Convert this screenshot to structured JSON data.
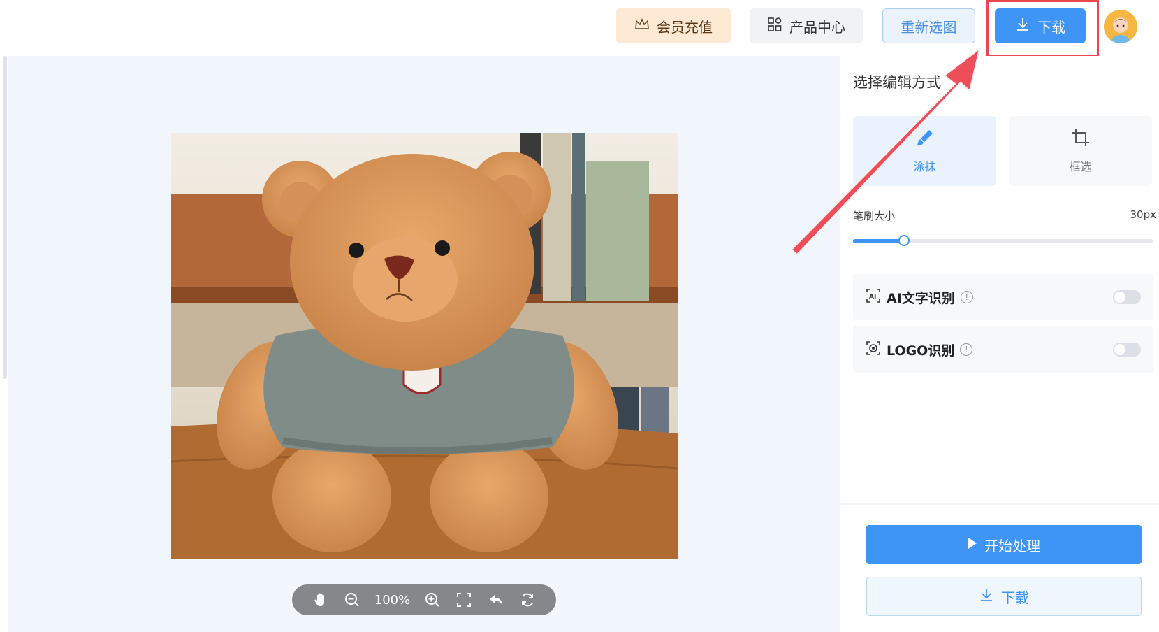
{
  "header": {
    "vip_label": "会员充值",
    "product_label": "产品中心",
    "reselect_label": "重新选图",
    "download_label": "下载"
  },
  "toolbar": {
    "zoom": "100%"
  },
  "panel": {
    "title": "选择编辑方式",
    "modes": [
      {
        "label": "涂抹",
        "selected": true
      },
      {
        "label": "框选",
        "selected": false
      }
    ],
    "brush": {
      "label": "笔刷大小",
      "value": "30px",
      "level": 0.17
    },
    "options": [
      {
        "label": "AI文字识别",
        "enabled": false
      },
      {
        "label": "LOGO识别",
        "enabled": false
      }
    ],
    "start_label": "开始处理",
    "download_label": "下载"
  },
  "colors": {
    "accent": "#3e95f5",
    "highlight": "#e8484d",
    "vip_bg": "#fde9d4"
  }
}
